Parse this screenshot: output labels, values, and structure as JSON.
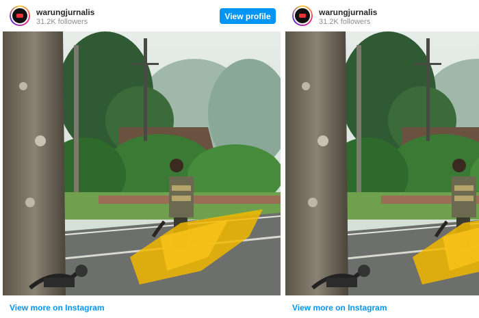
{
  "embeds": [
    {
      "username": "warungjurnalis",
      "followers": "31.2K followers",
      "view_profile_label": "View profile",
      "footer_link": "View more on Instagram"
    },
    {
      "username": "warungjurnalis",
      "followers": "31.2K followers",
      "footer_link": "View more on Instagram"
    }
  ],
  "colors": {
    "accent": "#0095f6",
    "username": "#262626",
    "muted": "#8e8e8e"
  }
}
